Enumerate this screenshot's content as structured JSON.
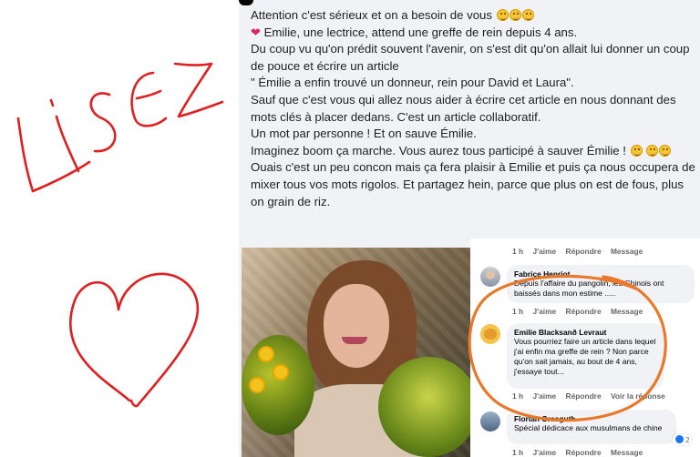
{
  "handwriting": {
    "word": "LISEZ",
    "color": "#e02020"
  },
  "post": {
    "paragraphs": [
      {
        "text": "Attention c'est sérieux et on a besoin de vous",
        "emojis": 3
      },
      {
        "prefix_icon": "heart",
        "text": " Emilie, une lectrice, attend une greffe de rein depuis 4 ans."
      },
      {
        "text": "Du coup vu qu'on prédit souvent l'avenir, on s'est dit qu'on allait lui donner un coup de pouce et écrire un article"
      },
      {
        "text": "\" Émilie a enfin trouvé un donneur, rein pour David et Laura\"."
      },
      {
        "text": "Sauf que c'est vous qui allez nous aider à écrire cet article en nous donnant des mots clés à placer dedans. C'est un article collaboratif."
      },
      {
        "text": "Un mot par personne ! Et on sauve Émilie."
      },
      {
        "text": "Imaginez boom ça marche. Vous aurez tous participé à sauver Émilie !",
        "emojis": 3
      },
      {
        "text": "Ouais c'est un peu concon mais ça fera plaisir à Emilie et puis ça nous occupera de mixer tous vos mots rigolos. Et partagez hein, parce que plus on est de fous, plus on grain de riz."
      }
    ]
  },
  "comments": {
    "top_actions": {
      "time": "1 h",
      "like": "J'aime",
      "reply": "Répondre",
      "message": "Message"
    },
    "items": [
      {
        "avatar": "profile-photo-man",
        "name": "Fabrice Henriot",
        "text": "Depuis l'affaire du pangolin, les Chinois ont baissés dans mon estime .....",
        "actions": {
          "time": "1 h",
          "like": "J'aime",
          "reply": "Répondre",
          "message": "Message"
        }
      },
      {
        "avatar": "profile-photo-cat",
        "name": "Emilie Blacksanð Levraut",
        "text": "Vous pourriez faire un article dans lequel j'ai enfin ma greffe de rein ? Non parce qu'on sait jamais, au bout de 4 ans, j'essaye tout...",
        "actions": {
          "time": "1 h",
          "like": "J'aime",
          "reply": "Répondre",
          "message": "Voir la réponse"
        }
      },
      {
        "avatar": "profile-photo",
        "name": "Florian Grasguth",
        "text": "Spécial dédicace aux musulmans de chine",
        "reactions": "2",
        "actions": {
          "time": "1 h",
          "like": "J'aime",
          "reply": "Répondre",
          "message": "Message"
        }
      }
    ]
  },
  "colors": {
    "annotation_red": "#e02020",
    "annotation_orange": "#e8792a",
    "card_bg": "#f0f2f5"
  }
}
